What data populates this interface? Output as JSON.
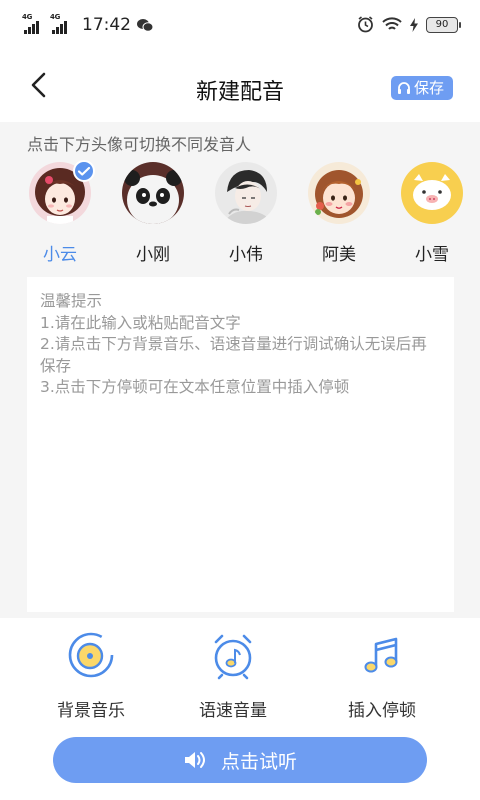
{
  "status_bar": {
    "network_1": "4G",
    "network_2": "4G",
    "time": "17:42",
    "battery": "90"
  },
  "header": {
    "title": "新建配音",
    "save_label": "保存",
    "accent": "#6e9df2"
  },
  "main": {
    "hint": "点击下方头像可切换不同发音人",
    "voices": [
      {
        "name": "小云",
        "selected": true
      },
      {
        "name": "小刚",
        "selected": false
      },
      {
        "name": "小伟",
        "selected": false
      },
      {
        "name": "阿美",
        "selected": false
      },
      {
        "name": "小雪",
        "selected": false
      }
    ],
    "text_input": {
      "value": "",
      "placeholder": "温馨提示\n1.请在此输入或粘贴配音文字\n2.请点击下方背景音乐、语速音量进行调试确认无误后再保存\n3.点击下方停顿可在文本任意位置中插入停顿"
    }
  },
  "tools": {
    "background_music": "背景音乐",
    "speed_volume": "语速音量",
    "insert_pause": "插入停顿"
  },
  "listen_label": "点击试听"
}
